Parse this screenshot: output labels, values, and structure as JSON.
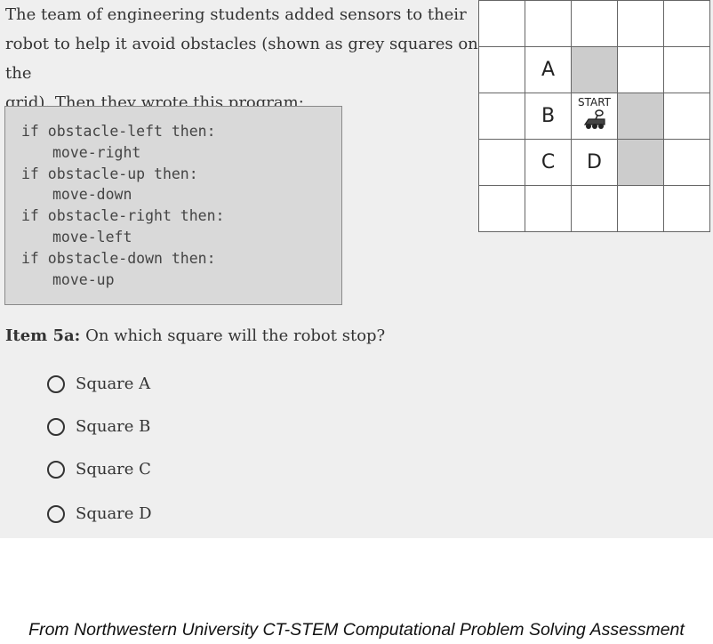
{
  "intro": {
    "line1": "The team of engineering students added sensors to their",
    "line2": "robot to help it avoid obstacles (shown as grey squares on the",
    "line3": "grid). Then they wrote this program:"
  },
  "code": {
    "lines": [
      "if obstacle-left then:",
      "move-right",
      "if obstacle-up then:",
      "move-down",
      "if obstacle-right then:",
      "move-left",
      "if obstacle-down then:",
      "move-up"
    ]
  },
  "grid": {
    "obstacle_color": "#cccccc",
    "cells": [
      [
        "",
        "",
        "",
        "",
        ""
      ],
      [
        "",
        "A",
        "",
        "",
        ""
      ],
      [
        "",
        "B",
        "START",
        "",
        ""
      ],
      [
        "",
        "C",
        "D",
        "",
        ""
      ],
      [
        "",
        "",
        "",
        "",
        ""
      ]
    ],
    "obstacles": [
      [
        1,
        2
      ],
      [
        2,
        3
      ],
      [
        3,
        3
      ]
    ],
    "start_label": "START",
    "start_icon": "robot-icon"
  },
  "question": {
    "label": "Item 5a:",
    "text": "On which square will the robot stop?"
  },
  "options": [
    "Square A",
    "Square B",
    "Square C",
    "Square D"
  ],
  "footer": "From Northwestern University CT-STEM Computational Problem Solving Assessment"
}
